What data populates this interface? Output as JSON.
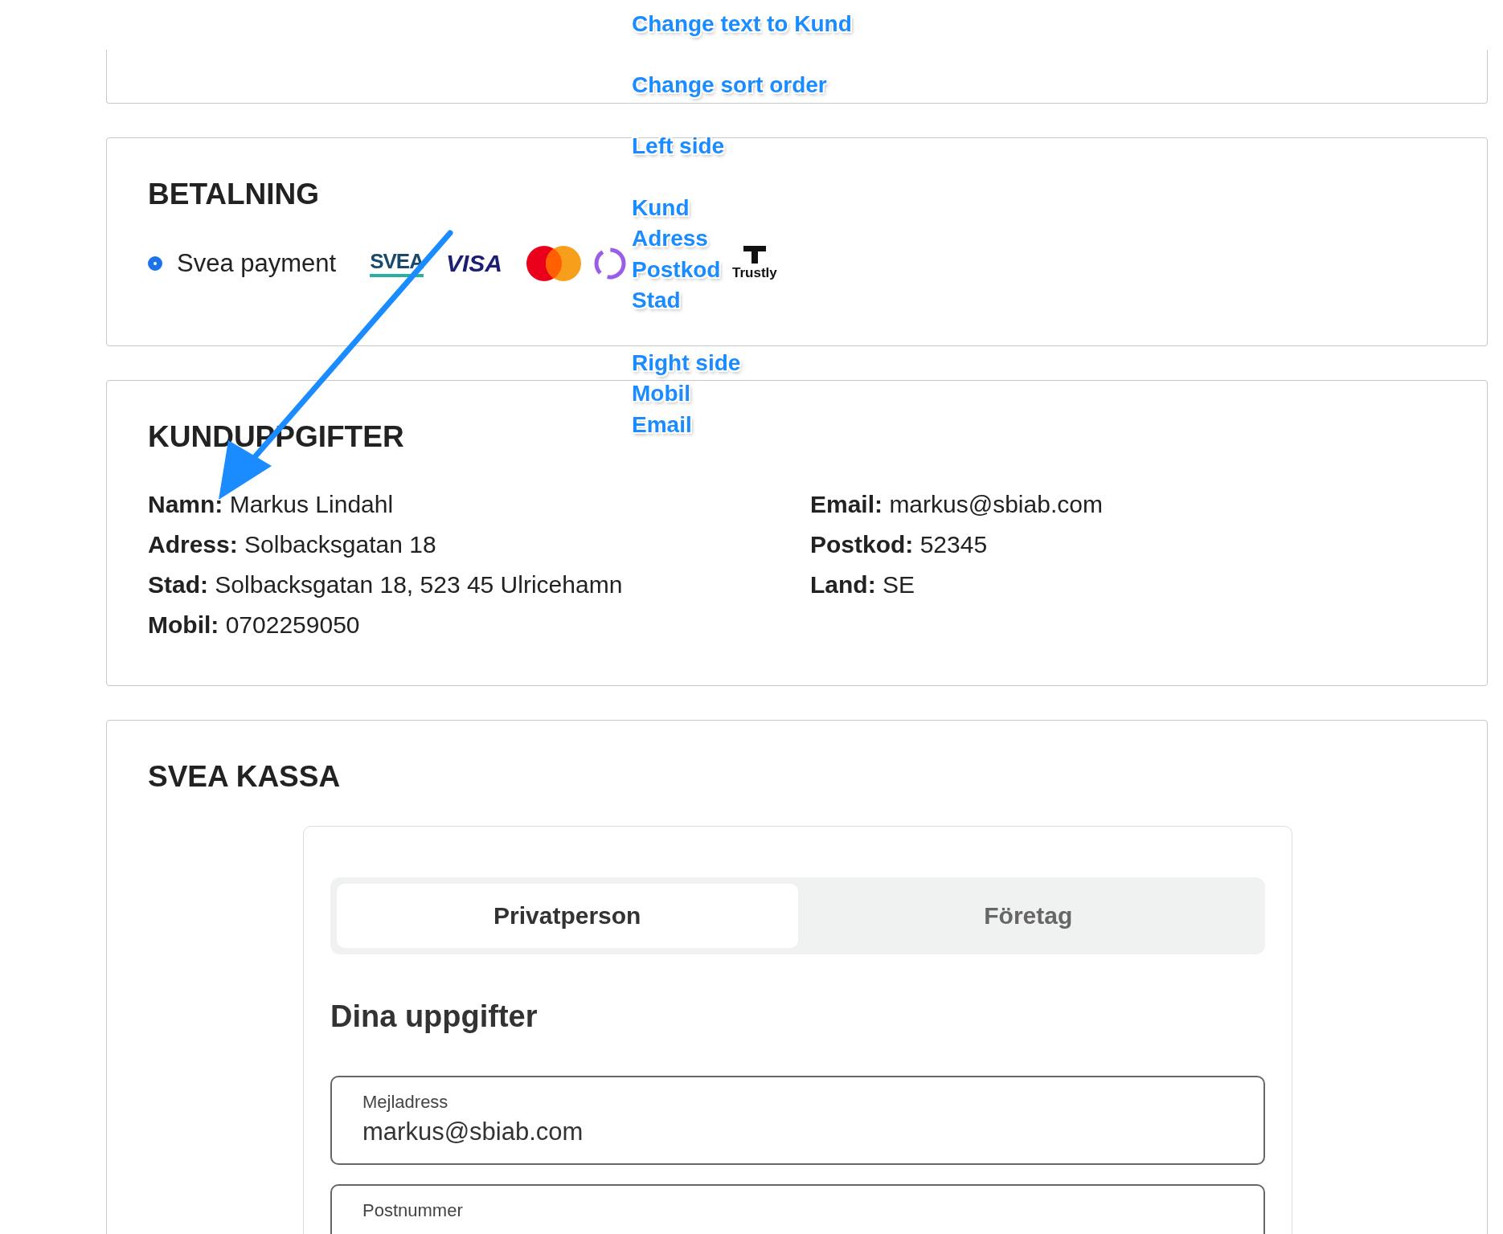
{
  "payment": {
    "title": "BETALNING",
    "options": [
      {
        "label": "Svea payment",
        "selected": true
      }
    ],
    "logos": [
      {
        "kind": "svea",
        "text": "SVEA"
      },
      {
        "kind": "visa",
        "text": "VISA"
      },
      {
        "kind": "mastercard"
      },
      {
        "kind": "swish"
      },
      {
        "kind": "trustly",
        "text": "Trustly"
      }
    ]
  },
  "customer": {
    "title": "KUNDUPPGIFTER",
    "left": [
      {
        "label": "Namn:",
        "value": "Markus Lindahl"
      },
      {
        "label": "Adress:",
        "value": "Solbacksgatan 18"
      },
      {
        "label": "Stad:",
        "value": "Solbacksgatan 18, 523 45 Ulricehamn"
      },
      {
        "label": "Mobil:",
        "value": "0702259050"
      }
    ],
    "right": [
      {
        "label": "Email:",
        "value": "markus@sbiab.com"
      },
      {
        "label": "Postkod:",
        "value": "52345"
      },
      {
        "label": "Land:",
        "value": "SE"
      }
    ]
  },
  "svea_kassa": {
    "title": "SVEA KASSA",
    "tabs": [
      {
        "label": "Privatperson",
        "selected": true
      },
      {
        "label": "Företag",
        "selected": false
      }
    ],
    "section_title": "Dina uppgifter",
    "fields": [
      {
        "label": "Mejladress",
        "value": "markus@sbiab.com"
      },
      {
        "label": "Postnummer"
      }
    ]
  },
  "annotations": [
    "Change text to Kund",
    "Change sort order",
    "Left side",
    "Kund",
    "Adress",
    "Postkod",
    "Stad",
    "Right side",
    "Mobil",
    "Email"
  ]
}
